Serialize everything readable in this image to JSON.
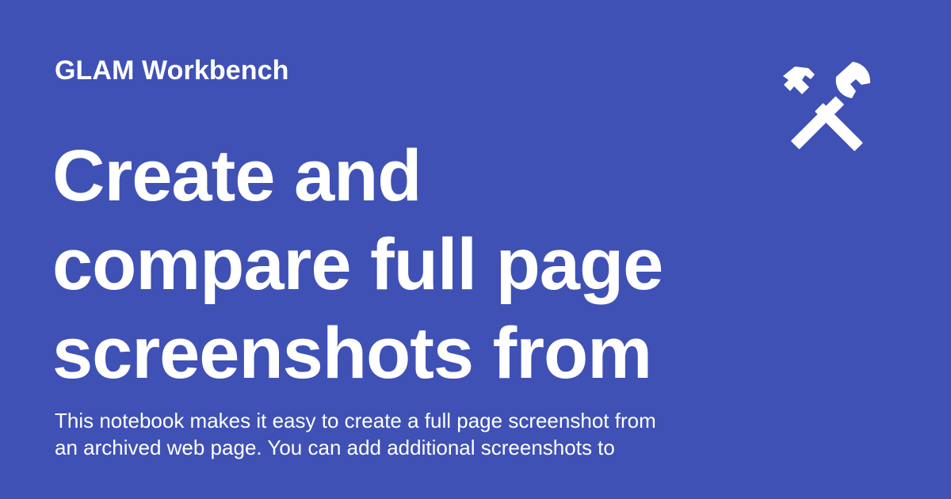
{
  "site": {
    "name": "GLAM Workbench"
  },
  "hero": {
    "title_lines": [
      "Create and",
      "compare full page",
      "screenshots from"
    ],
    "description_lines": [
      "This notebook makes it easy to create a full page screenshot from",
      "an archived web page. You can add additional screenshots to"
    ]
  },
  "logo": {
    "icon": "hammer-and-wrench-icon",
    "color": "#ffffff"
  },
  "theme": {
    "background": "#3f51b5",
    "text": "#ffffff"
  }
}
